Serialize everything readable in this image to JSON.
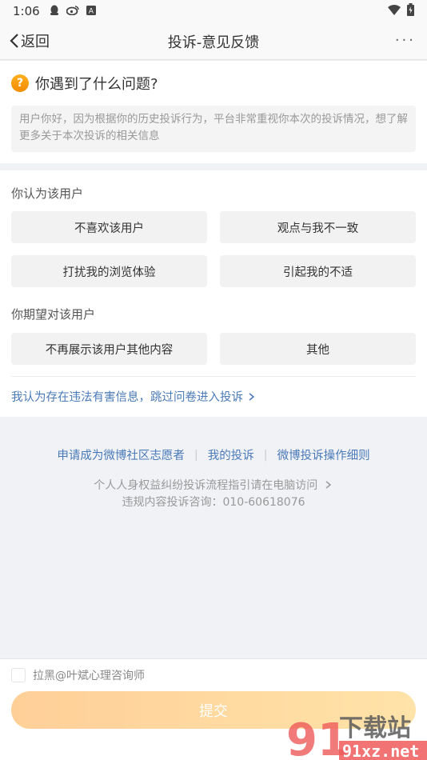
{
  "status_bar": {
    "time": "1:06",
    "left_icons": [
      "qq-icon",
      "weibo-icon",
      "a-icon"
    ],
    "right_icons": [
      "wifi-icon",
      "battery-icon"
    ]
  },
  "nav": {
    "back_label": "返回",
    "title": "投诉-意见反馈",
    "more_label": "···"
  },
  "question": {
    "title": "你遇到了什么问题?",
    "hint": "用户你好，因为根据你的历史投诉行为，平台非常重视你本次的投诉情况，想了解更多关于本次投诉的相关信息"
  },
  "section1": {
    "label": "你认为该用户",
    "options": [
      "不喜欢该用户",
      "观点与我不一致",
      "打扰我的浏览体验",
      "引起我的不适"
    ]
  },
  "section2": {
    "label": "你期望对该用户",
    "options": [
      "不再展示该用户其他内容",
      "其他"
    ]
  },
  "skip_link": "我认为存在违法有害信息，跳过问卷进入投诉",
  "footer": {
    "links": [
      "申请成为微博社区志愿者",
      "我的投诉",
      "微博投诉操作细则"
    ],
    "guide": "个人人身权益纠纷投诉流程指引请在电脑访问",
    "hotline": "违规内容投诉咨询：010-60618076"
  },
  "bottom": {
    "block_label": "拉黑@叶斌心理咨询师",
    "block_checked": false,
    "submit_label": "提交"
  },
  "watermark": {
    "logo": "91",
    "title": "下载站",
    "domain": "91xz.net"
  },
  "colors": {
    "link": "#4a7ab8",
    "accent": "#f28b00",
    "submit_start": "#ffcf98",
    "submit_end": "#ffe3a8"
  }
}
